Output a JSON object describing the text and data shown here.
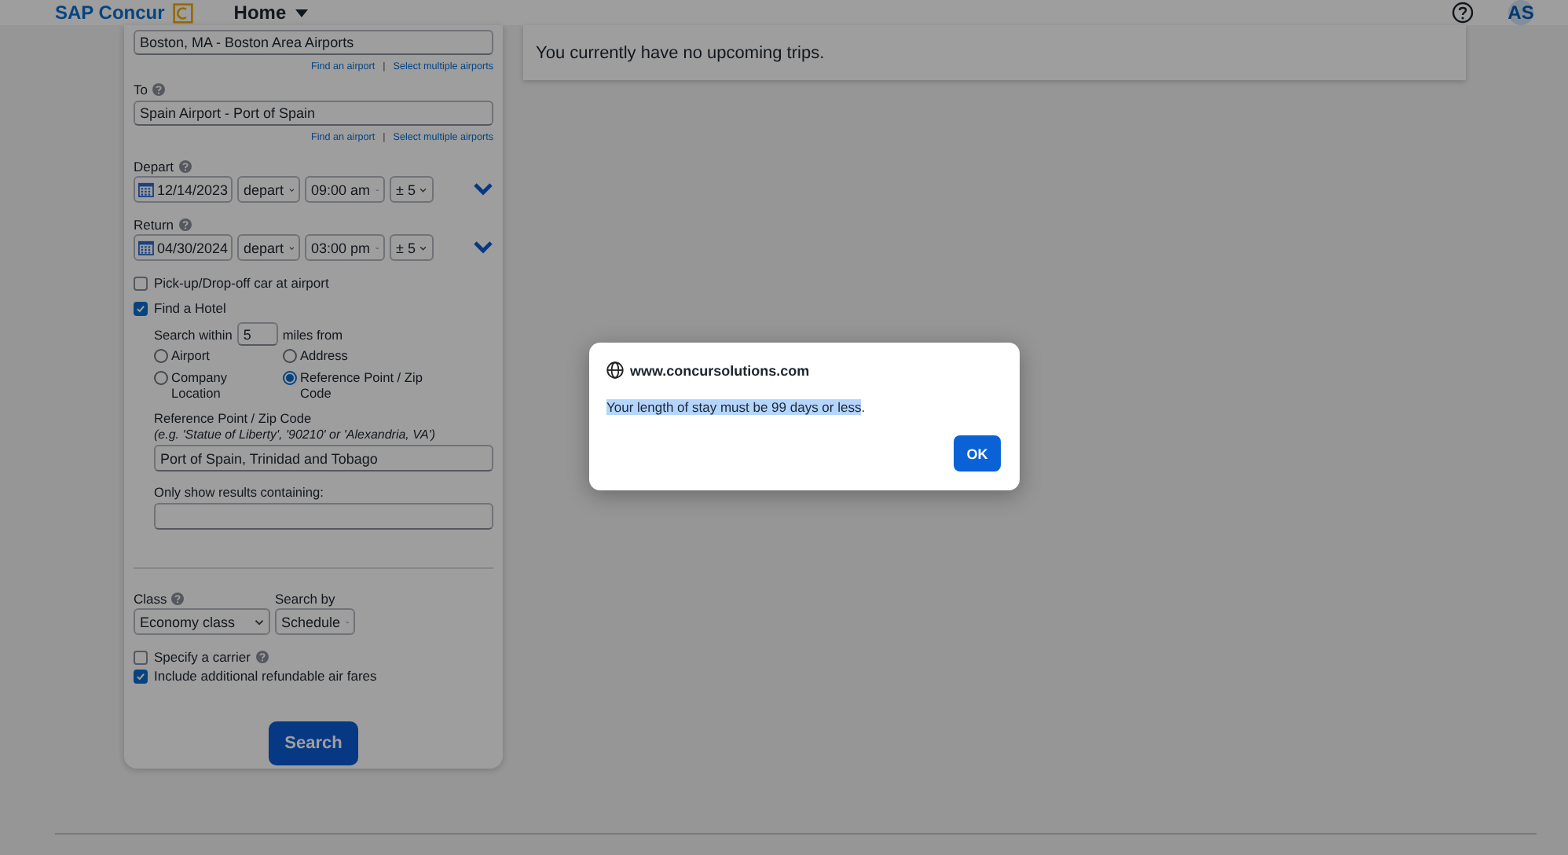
{
  "header": {
    "logo": "SAP Concur",
    "nav": "Home",
    "avatar": "AS"
  },
  "trips_panel": {
    "message": "You currently have no upcoming trips."
  },
  "flight_form": {
    "from": {
      "value": "Boston, MA - Boston Area Airports",
      "links": [
        "Find an airport",
        "Select multiple airports"
      ],
      "separator": "|"
    },
    "to": {
      "label": "To",
      "value": "Spain Airport - Port of Spain",
      "links": [
        "Find an airport",
        "Select multiple airports"
      ],
      "separator": "|"
    },
    "dates": [
      {
        "label": "Depart",
        "date": "12/14/2023",
        "mode": "depart",
        "time": "09:00 am",
        "window": "± 5"
      },
      {
        "label": "Return",
        "date": "04/30/2024",
        "mode": "depart",
        "time": "03:00 pm",
        "window": "± 5"
      }
    ],
    "options": [
      {
        "label": "Pick-up/Drop-off car at airport",
        "checked": false
      },
      {
        "label": "Find a Hotel",
        "checked": true
      }
    ],
    "hotel": {
      "search_within_label": "Search within",
      "radius": "5",
      "miles_label": "miles from",
      "locations": [
        {
          "label": "Airport",
          "selected": false
        },
        {
          "label": "Address",
          "selected": false
        },
        {
          "label": "Company Location",
          "selected": false
        },
        {
          "label": "Reference Point / Zip Code",
          "selected": true
        }
      ],
      "reference_label": "Reference Point / Zip Code",
      "reference_hint": "(e.g. 'Statue of Liberty', '90210' or 'Alexandria, VA')",
      "reference_value": "Port of Spain, Trinidad and Tobago",
      "filter_label": "Only show results containing:"
    },
    "class": {
      "label": "Class",
      "value": "Economy class"
    },
    "search_by": {
      "label": "Search by",
      "value": "Schedule"
    },
    "extras": [
      {
        "label": "Specify a carrier",
        "checked": false,
        "help": true
      },
      {
        "label": "Include additional refundable air fares",
        "checked": true,
        "help": false
      }
    ],
    "search_button": "Search"
  },
  "dialog": {
    "origin": "www.concursolutions.com",
    "message_selected": "Your length of stay must be 99 days or less",
    "message_rest": ".",
    "button": "OK"
  }
}
